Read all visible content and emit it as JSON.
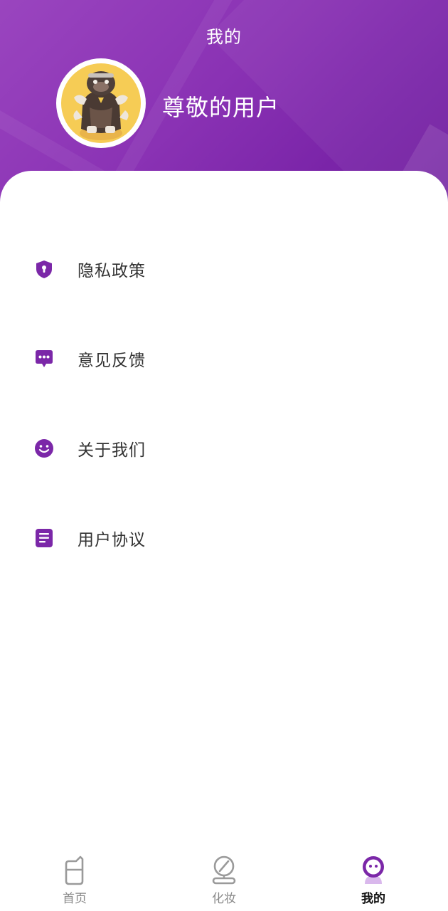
{
  "header": {
    "title": "我的",
    "user_name": "尊敬的用户"
  },
  "menu": [
    {
      "label": "隐私政策",
      "icon": "shield-lock-icon"
    },
    {
      "label": "意见反馈",
      "icon": "chat-bubble-icon"
    },
    {
      "label": "关于我们",
      "icon": "smile-face-icon"
    },
    {
      "label": "用户协议",
      "icon": "document-icon"
    }
  ],
  "tabbar": {
    "items": [
      {
        "label": "首页",
        "icon": "home-cup-icon",
        "active": false
      },
      {
        "label": "化妆",
        "icon": "mirror-icon",
        "active": false
      },
      {
        "label": "我的",
        "icon": "user-robot-icon",
        "active": true
      }
    ]
  },
  "colors": {
    "accent": "#7b27a8",
    "header_start": "#9a45bf",
    "header_end": "#6e1c9e",
    "tab_inactive": "#888888",
    "tab_active": "#111111"
  }
}
